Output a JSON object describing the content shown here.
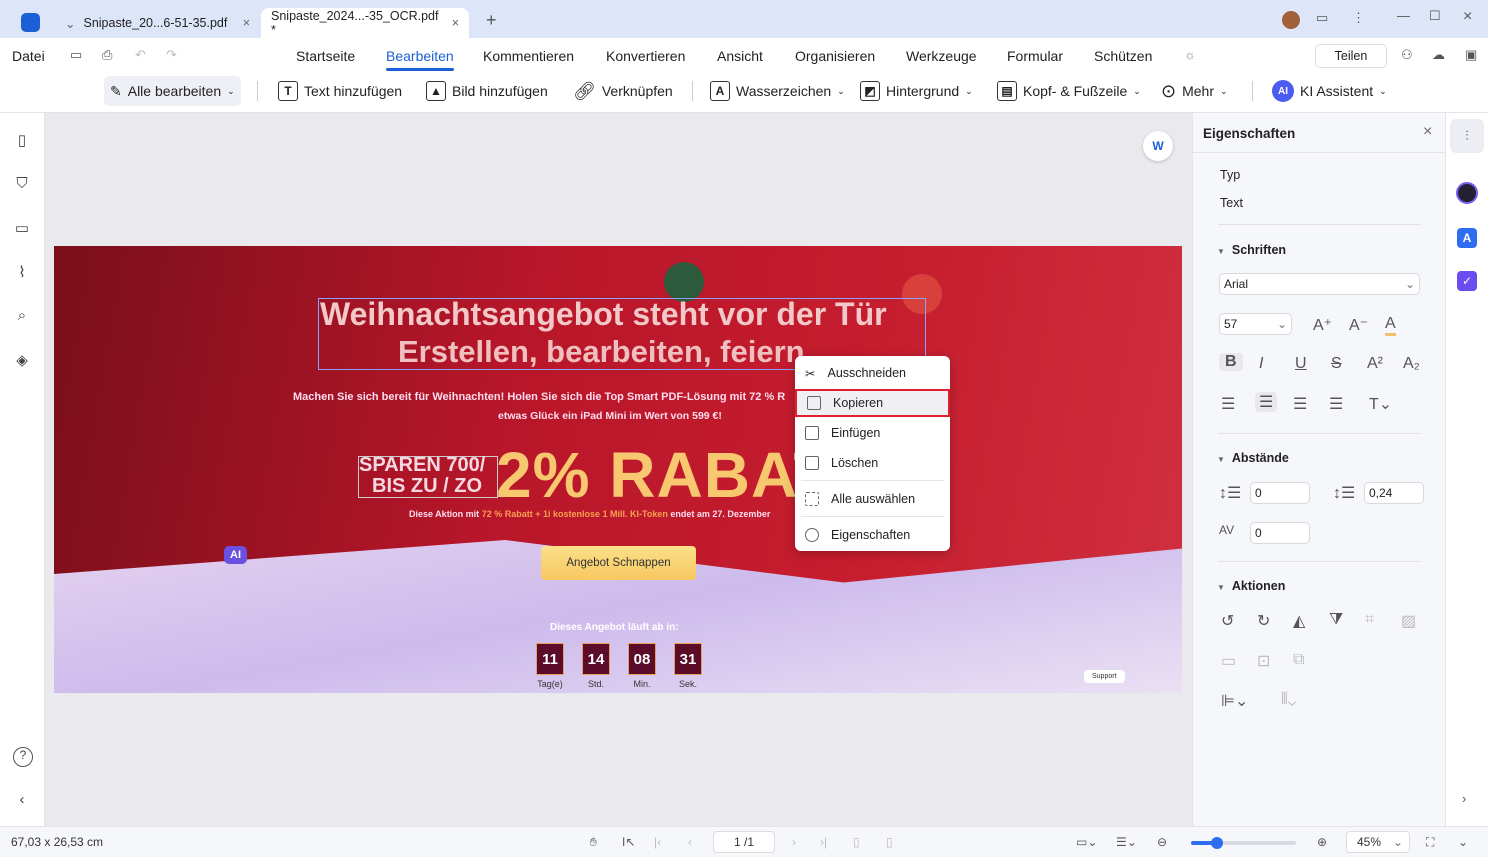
{
  "tabs": [
    {
      "label": "Snipaste_20...6-51-35.pdf",
      "active": false
    },
    {
      "label": "Snipaste_2024...-35_OCR.pdf *",
      "active": true
    }
  ],
  "menu": {
    "file": "Datei",
    "items": [
      "Startseite",
      "Bearbeiten",
      "Kommentieren",
      "Konvertieren",
      "Ansicht",
      "Organisieren",
      "Werkzeuge",
      "Formular",
      "Schützen"
    ],
    "active": "Bearbeiten",
    "share": "Teilen"
  },
  "toolbar": {
    "edit_all": "Alle bearbeiten",
    "add_text": "Text hinzufügen",
    "add_image": "Bild hinzufügen",
    "link": "Verknüpfen",
    "watermark": "Wasserzeichen",
    "background": "Hintergrund",
    "header_footer": "Kopf- & Fußzeile",
    "more": "Mehr",
    "ai": "KI Assistent"
  },
  "banner": {
    "title1": "Weihnachtsangebot steht vor der Tür",
    "title2": "Erstellen, bearbeiten, feiern",
    "line1": "Machen Sie sich bereit für Weihnachten! Holen Sie sich die Top Smart PDF-Lösung mit 72 % R",
    "line2": "etwas Glück ein iPad Mini im Wert von 599 €!",
    "save1": "SPAREN 700/",
    "save2": "BIS ZU / ZO",
    "rabatt": "2% RABAT",
    "promo_a": "Diese Aktion mit ",
    "promo_b": "72 % Rabatt + 1i kostenlose 1 Mill. KI-Token",
    "promo_c": " endet am 27. Dezember",
    "cta": "Angebot Schnappen",
    "expires": "Dieses Angebot läuft ab in:",
    "countdown": [
      {
        "v": "11",
        "l": "Tag(e)"
      },
      {
        "v": "14",
        "l": "Std."
      },
      {
        "v": "08",
        "l": "Min."
      },
      {
        "v": "31",
        "l": "Sek."
      }
    ],
    "support": "Support",
    "ai_badge": "AI"
  },
  "context_menu": {
    "items": [
      "Ausschneiden",
      "Kopieren",
      "Einfügen",
      "Löschen",
      "Alle auswählen",
      "Eigenschaften"
    ],
    "highlighted": "Kopieren"
  },
  "properties": {
    "title": "Eigenschaften",
    "type_label": "Typ",
    "type_value": "Text",
    "fonts_label": "Schriften",
    "font": "Arial",
    "size": "57",
    "spacing_label": "Abstände",
    "line_spacing": "0",
    "para_spacing": "0,24",
    "char_spacing": "0",
    "actions_label": "Aktionen"
  },
  "status": {
    "dimensions": "67,03 x 26,53 cm",
    "page": "1 /1",
    "zoom": "45%",
    "zoom_fraction": 0.25
  },
  "colors": {
    "accent": "#1a5fd6",
    "highlight_border": "#e02030"
  }
}
